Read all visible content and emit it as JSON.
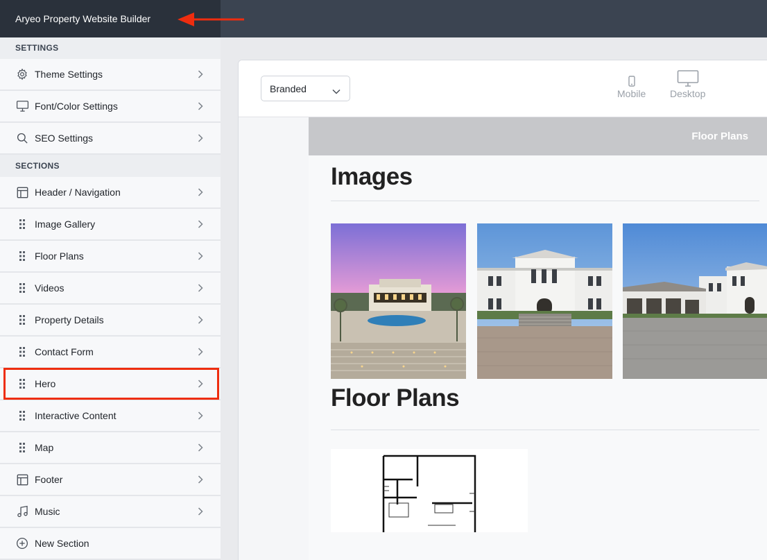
{
  "app": {
    "title": "Aryeo Property Website Builder"
  },
  "sidebar": {
    "settings_header": "SETTINGS",
    "settings": [
      {
        "label": "Theme Settings",
        "icon": "gear-icon"
      },
      {
        "label": "Font/Color Settings",
        "icon": "monitor-icon"
      },
      {
        "label": "SEO Settings",
        "icon": "search-icon"
      }
    ],
    "sections_header": "SECTIONS",
    "sections": [
      {
        "label": "Header / Navigation",
        "icon": "layout-icon"
      },
      {
        "label": "Image Gallery",
        "icon": "drag-handle-icon"
      },
      {
        "label": "Floor Plans",
        "icon": "drag-handle-icon"
      },
      {
        "label": "Videos",
        "icon": "drag-handle-icon"
      },
      {
        "label": "Property Details",
        "icon": "drag-handle-icon"
      },
      {
        "label": "Contact Form",
        "icon": "drag-handle-icon"
      },
      {
        "label": "Hero",
        "icon": "drag-handle-icon"
      },
      {
        "label": "Interactive Content",
        "icon": "drag-handle-icon"
      },
      {
        "label": "Map",
        "icon": "drag-handle-icon"
      },
      {
        "label": "Footer",
        "icon": "layout-icon"
      },
      {
        "label": "Music",
        "icon": "music-icon"
      },
      {
        "label": "New Section",
        "icon": "plus-circle-icon"
      }
    ]
  },
  "toolbar": {
    "theme_select": "Branded",
    "devices": [
      {
        "label": "Mobile",
        "icon": "mobile-icon"
      },
      {
        "label": "Desktop",
        "icon": "desktop-icon"
      }
    ]
  },
  "preview": {
    "nav_link": "Floor Plans",
    "images_heading": "Images",
    "floorplans_heading": "Floor Plans"
  },
  "colors": {
    "topbar": "#3b4451",
    "topbar_title_bg": "#2a313b",
    "annotation_red": "#ee2d0f"
  }
}
